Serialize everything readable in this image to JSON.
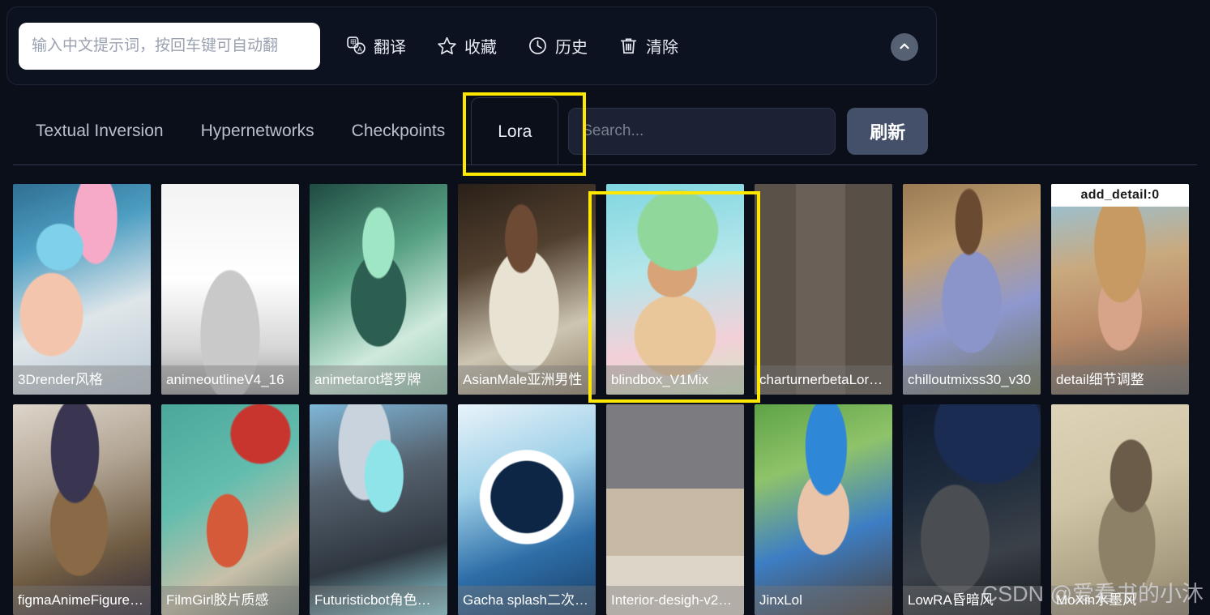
{
  "prompt_panel": {
    "input_placeholder": "输入中文提示词，按回车键可自动翻",
    "input_value": "",
    "actions": [
      {
        "label": "翻译",
        "icon": "translate-icon"
      },
      {
        "label": "收藏",
        "icon": "star-icon"
      },
      {
        "label": "历史",
        "icon": "clock-icon"
      },
      {
        "label": "清除",
        "icon": "trash-icon"
      }
    ],
    "collapse_icon": "chevron-up-icon"
  },
  "tabbar": {
    "tabs": [
      {
        "label": "Textual Inversion",
        "active": false
      },
      {
        "label": "Hypernetworks",
        "active": false
      },
      {
        "label": "Checkpoints",
        "active": false
      },
      {
        "label": "Lora",
        "active": true
      }
    ],
    "search_placeholder": "Search...",
    "search_value": "",
    "refresh_label": "刷新"
  },
  "cards": [
    {
      "label": "3Drender风格",
      "thumb": "t-3drender",
      "tooltip": null,
      "highlighted": false
    },
    {
      "label": "animeoutlineV4_16",
      "thumb": "t-animeoutline",
      "tooltip": null,
      "highlighted": false
    },
    {
      "label": "animetarot塔罗牌",
      "thumb": "t-animetarot",
      "tooltip": null,
      "highlighted": false
    },
    {
      "label": "AsianMale亚洲男性",
      "thumb": "t-asianmale",
      "tooltip": null,
      "highlighted": false
    },
    {
      "label": "blindbox_V1Mix",
      "thumb": "t-blindbox",
      "tooltip": null,
      "highlighted": true
    },
    {
      "label": "charturnerbetaLor…",
      "thumb": "t-charturner",
      "tooltip": null,
      "highlighted": false
    },
    {
      "label": "chilloutmixss30_v30",
      "thumb": "t-chilloutmix",
      "tooltip": null,
      "highlighted": false
    },
    {
      "label": "detail细节调整",
      "thumb": "t-detail",
      "tooltip": "add_detail:0",
      "highlighted": false
    },
    {
      "label": "figmaAnimeFigure…",
      "thumb": "t-figma",
      "tooltip": null,
      "highlighted": false
    },
    {
      "label": "FilmGirl胶片质感",
      "thumb": "t-filmgirl",
      "tooltip": null,
      "highlighted": false
    },
    {
      "label": "Futuristicbot角色…",
      "thumb": "t-futuristic",
      "tooltip": null,
      "highlighted": false
    },
    {
      "label": "Gacha splash二次…",
      "thumb": "t-gacha",
      "tooltip": null,
      "highlighted": false
    },
    {
      "label": "Interior-desigh-v2…",
      "thumb": "t-interior",
      "tooltip": null,
      "highlighted": false
    },
    {
      "label": "JinxLol",
      "thumb": "t-jinx",
      "tooltip": null,
      "highlighted": false
    },
    {
      "label": "LowRA昏暗风",
      "thumb": "t-lowra",
      "tooltip": null,
      "highlighted": false
    },
    {
      "label": "MoXin水墨风",
      "thumb": "t-moxin",
      "tooltip": null,
      "highlighted": false
    }
  ],
  "annotations": {
    "accent_color": "#ffe800",
    "boxes": [
      "lora-tab",
      "blindbox-card"
    ]
  },
  "watermark": {
    "text": "CSDN @爱看书的小沐"
  }
}
